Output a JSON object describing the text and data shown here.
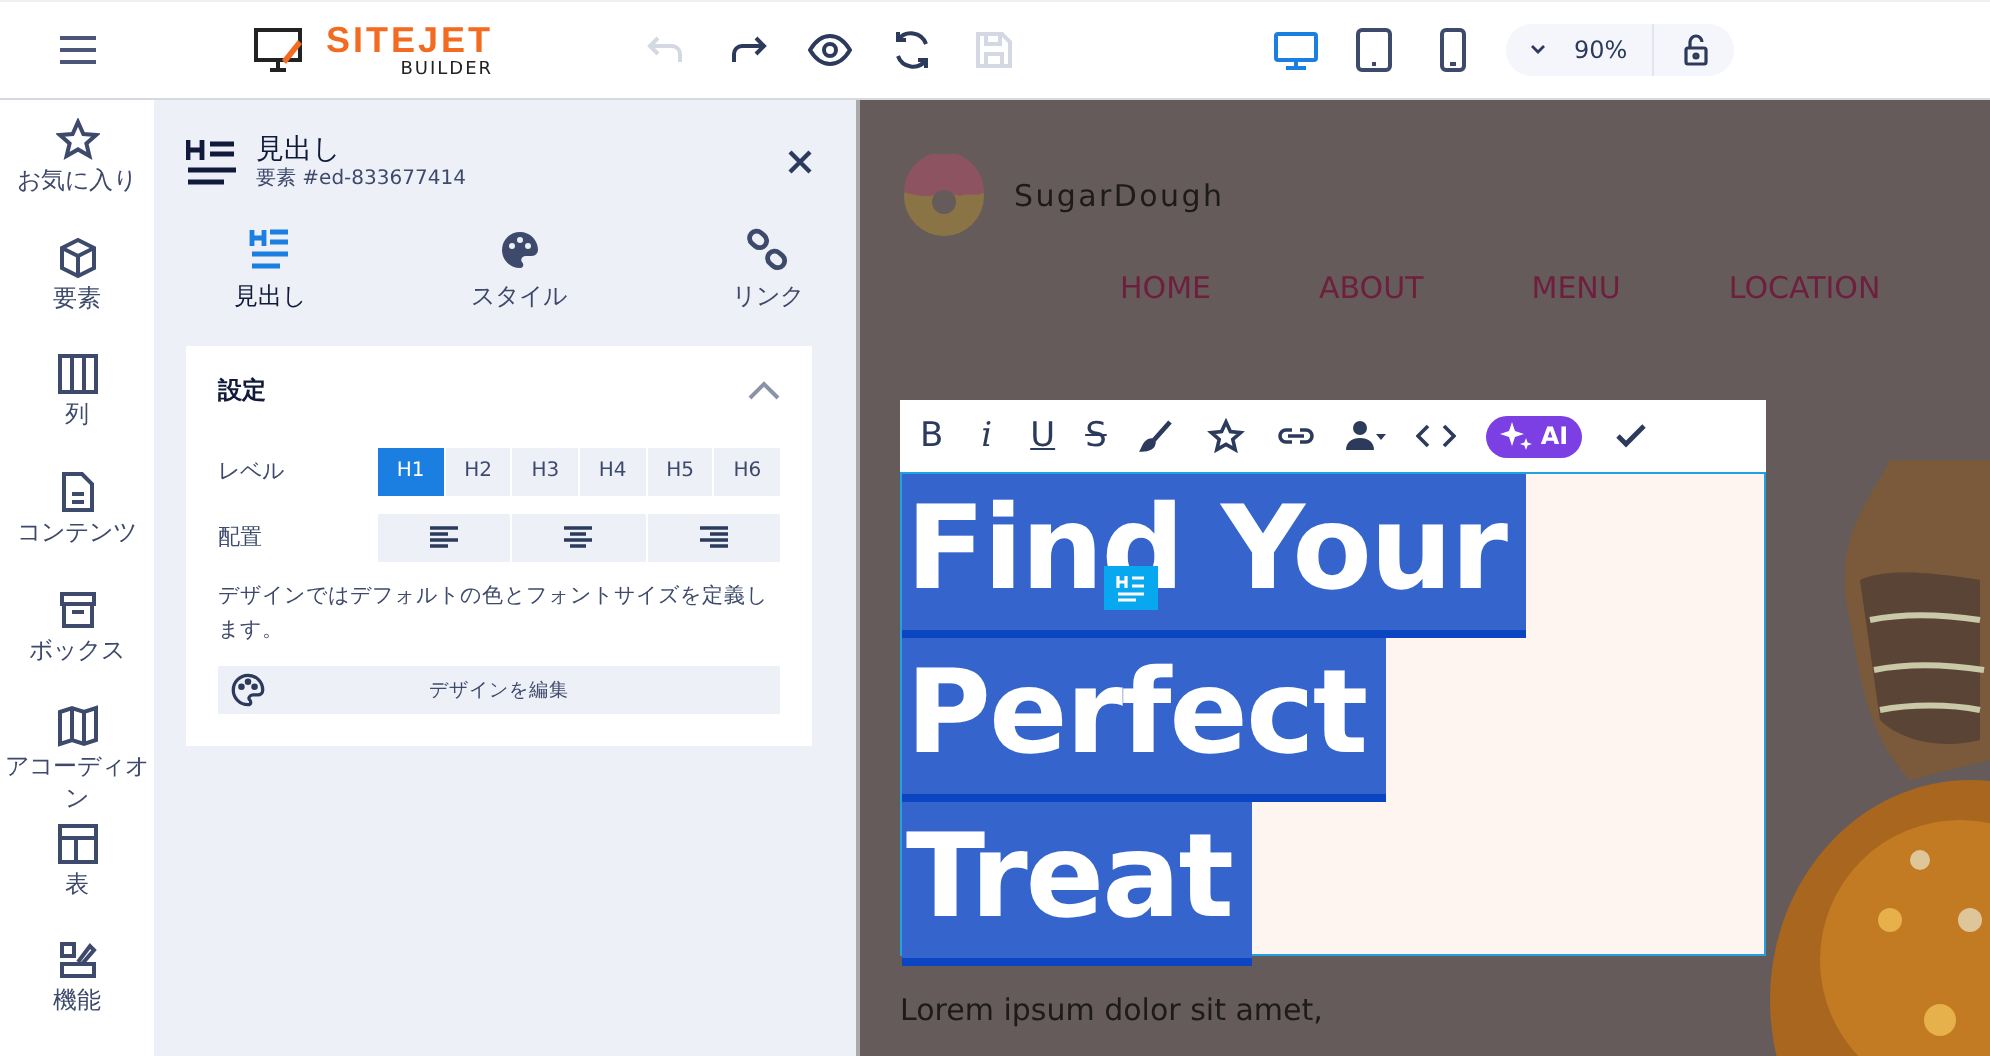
{
  "topbar": {
    "logo": {
      "name": "SITEJET",
      "sub": "BUILDER"
    },
    "actions": [
      {
        "kind": "undo",
        "disabled": true
      },
      {
        "kind": "redo",
        "disabled": false
      },
      {
        "kind": "preview",
        "disabled": false
      },
      {
        "kind": "refresh",
        "disabled": false
      },
      {
        "kind": "save",
        "disabled": true
      }
    ],
    "devices": [
      {
        "kind": "desktop",
        "selected": true
      },
      {
        "kind": "tablet",
        "selected": false
      },
      {
        "kind": "phone",
        "selected": false
      }
    ],
    "zoom": "90%",
    "locked": false
  },
  "rail": [
    {
      "kind": "star",
      "label": "お気に入り"
    },
    {
      "kind": "cube",
      "label": "要素"
    },
    {
      "kind": "columns",
      "label": "列"
    },
    {
      "kind": "doc",
      "label": "コンテンツ"
    },
    {
      "kind": "box",
      "label": "ボックス"
    },
    {
      "kind": "map",
      "label": "アコーディオン"
    },
    {
      "kind": "table",
      "label": "表"
    },
    {
      "kind": "feature",
      "label": "機能"
    }
  ],
  "panel": {
    "title": "見出し",
    "subtitle": "要素 #ed-833677414",
    "tabs": [
      {
        "kind": "heading",
        "label": "見出し",
        "selected": true
      },
      {
        "kind": "palette",
        "label": "スタイル",
        "selected": false
      },
      {
        "kind": "link",
        "label": "リンク",
        "selected": false
      }
    ],
    "section": {
      "title": "設定",
      "expanded": true,
      "level_label": "レベル",
      "levels": [
        {
          "label": "H1",
          "selected": true
        },
        {
          "label": "H2",
          "selected": false
        },
        {
          "label": "H3",
          "selected": false
        },
        {
          "label": "H4",
          "selected": false
        },
        {
          "label": "H5",
          "selected": false
        },
        {
          "label": "H6",
          "selected": false
        }
      ],
      "align_label": "配置",
      "aligns": [
        {
          "kind": "left",
          "selected": false
        },
        {
          "kind": "center",
          "selected": false
        },
        {
          "kind": "right",
          "selected": false
        }
      ],
      "description": "デザインではデフォルトの色とフォントサイズを定義します。",
      "edit_button": "デザインを編集"
    }
  },
  "canvas": {
    "brand": "SugarDough",
    "nav": [
      "HOME",
      "ABOUT",
      "MENU",
      "LOCATION"
    ],
    "toolbar": [
      {
        "kind": "bold",
        "label": "B"
      },
      {
        "kind": "italic",
        "label": "i"
      },
      {
        "kind": "underline",
        "label": "U"
      },
      {
        "kind": "strike",
        "label": "S"
      },
      {
        "kind": "brush"
      },
      {
        "kind": "star"
      },
      {
        "kind": "link"
      },
      {
        "kind": "person"
      },
      {
        "kind": "code"
      },
      {
        "kind": "ai",
        "label": "AI"
      },
      {
        "kind": "check"
      }
    ],
    "heading": [
      "Find Your",
      "Perfect",
      "Treat"
    ],
    "body": "Lorem ipsum dolor sit amet,"
  }
}
